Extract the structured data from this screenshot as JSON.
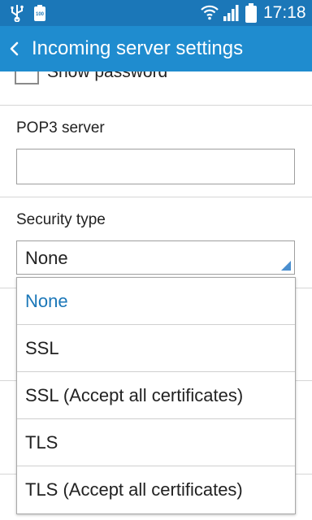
{
  "status_bar": {
    "battery_small_text": "100",
    "time": "17:18"
  },
  "action_bar": {
    "title": "Incoming server settings",
    "back_icon": "chevron-left-icon"
  },
  "form": {
    "show_password_label": "Show password",
    "show_password_checked": false,
    "pop3_server_label": "POP3 server",
    "pop3_server_value": "",
    "security_type_label": "Security type",
    "security_type_value": "None"
  },
  "dropdown": {
    "options": [
      {
        "label": "None",
        "selected": true
      },
      {
        "label": "SSL",
        "selected": false
      },
      {
        "label": "SSL (Accept all certificates)",
        "selected": false
      },
      {
        "label": "TLS",
        "selected": false
      },
      {
        "label": "TLS (Accept all certificates)",
        "selected": false
      }
    ]
  },
  "colors": {
    "status_bar": "#1b77b8",
    "action_bar": "#1f8ccf",
    "selected_text": "#1b77b8"
  }
}
